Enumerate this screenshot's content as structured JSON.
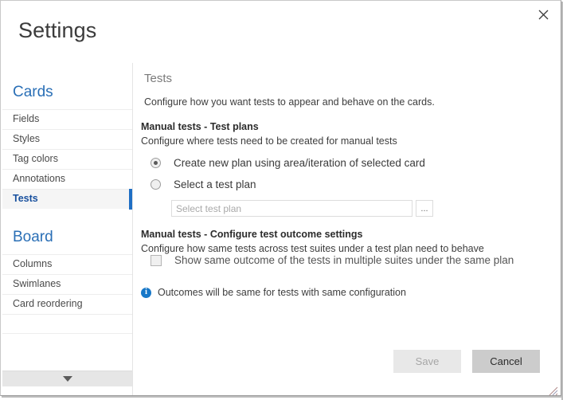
{
  "dialog": {
    "title": "Settings",
    "close_icon": "close-icon"
  },
  "sidebar": {
    "groups": [
      {
        "title": "Cards",
        "items": [
          {
            "label": "Fields",
            "selected": false
          },
          {
            "label": "Styles",
            "selected": false
          },
          {
            "label": "Tag colors",
            "selected": false
          },
          {
            "label": "Annotations",
            "selected": false
          },
          {
            "label": "Tests",
            "selected": true
          }
        ]
      },
      {
        "title": "Board",
        "items": [
          {
            "label": "Columns",
            "selected": false
          },
          {
            "label": "Swimlanes",
            "selected": false
          },
          {
            "label": "Card reordering",
            "selected": false
          }
        ]
      }
    ],
    "scroll_down_icon": "chevron-down-icon"
  },
  "main": {
    "section_title": "Tests",
    "section_description": "Configure how you want tests to appear and behave on the cards.",
    "group_plans": {
      "heading": "Manual tests - Test plans",
      "description": "Configure where tests need to be created for manual tests",
      "options": [
        {
          "label": "Create new plan using area/iteration of selected card",
          "checked": true
        },
        {
          "label": "Select a test plan",
          "checked": false
        }
      ],
      "plan_input_value": "",
      "plan_input_placeholder": "Select test plan",
      "browse_label": "..."
    },
    "group_outcome": {
      "heading": "Manual tests - Configure test outcome settings",
      "description": "Configure how same tests across test suites under a test plan need to behave",
      "checkbox_label": "Show same outcome of the tests in multiple suites under the same plan",
      "checkbox_checked": false,
      "info_icon": "info-icon",
      "info_text": "Outcomes will be same for tests with same configuration"
    }
  },
  "footer": {
    "save_label": "Save",
    "save_disabled": true,
    "cancel_label": "Cancel"
  },
  "colors": {
    "accent_blue": "#1f6fc4",
    "header_blue": "#2a6fb6",
    "selected_text": "#18509e",
    "info_blue": "#1878c8"
  }
}
